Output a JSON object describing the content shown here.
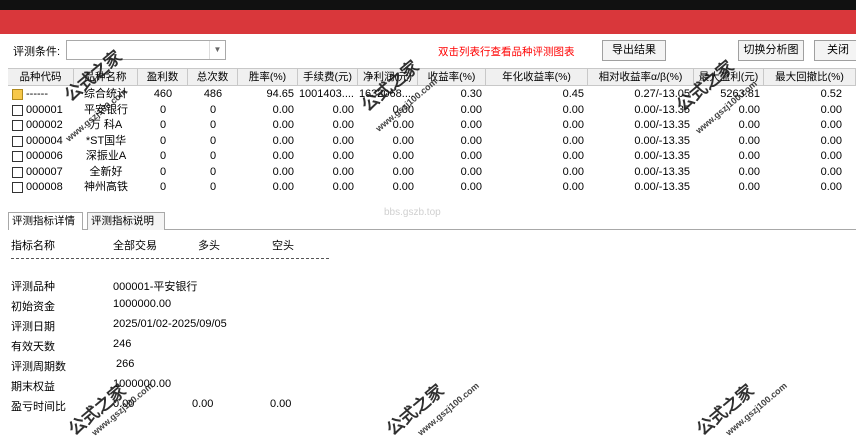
{
  "toolbar": {
    "condition_label": "评测条件:",
    "condition_value": "",
    "hint": "双击列表行查看品种评测图表",
    "export_button": "导出结果",
    "switch_button": "切换分析图",
    "close_button": "关闭"
  },
  "table": {
    "headers": [
      "品种代码",
      "品种名称",
      "盈利数",
      "总次数",
      "胜率(%)",
      "手续费(元)",
      "净利润(元)",
      "收益率(%)",
      "年化收益率(%)",
      "相对收益率α/β(%)",
      "最大盈利(元)",
      "最大回撤比(%)"
    ],
    "rows": [
      {
        "code": "------",
        "name": "综合统计",
        "win": "460",
        "total": "486",
        "rate": "94.65",
        "fee": "1001403....",
        "profit": "1632068....",
        "ret": "0.30",
        "annual": "0.45",
        "alpha": "0.27/-13.05",
        "maxp": "5263.81",
        "dd": "0.52",
        "folder": true
      },
      {
        "code": "000001",
        "name": "平安银行",
        "win": "0",
        "total": "0",
        "rate": "0.00",
        "fee": "0.00",
        "profit": "0.00",
        "ret": "0.00",
        "annual": "0.00",
        "alpha": "0.00/-13.35",
        "maxp": "0.00",
        "dd": "0.00",
        "folder": false
      },
      {
        "code": "000002",
        "name": "万 科A",
        "win": "0",
        "total": "0",
        "rate": "0.00",
        "fee": "0.00",
        "profit": "0.00",
        "ret": "0.00",
        "annual": "0.00",
        "alpha": "0.00/-13.35",
        "maxp": "0.00",
        "dd": "0.00",
        "folder": false
      },
      {
        "code": "000004",
        "name": "*ST国华",
        "win": "0",
        "total": "0",
        "rate": "0.00",
        "fee": "0.00",
        "profit": "0.00",
        "ret": "0.00",
        "annual": "0.00",
        "alpha": "0.00/-13.35",
        "maxp": "0.00",
        "dd": "0.00",
        "folder": false
      },
      {
        "code": "000006",
        "name": "深振业A",
        "win": "0",
        "total": "0",
        "rate": "0.00",
        "fee": "0.00",
        "profit": "0.00",
        "ret": "0.00",
        "annual": "0.00",
        "alpha": "0.00/-13.35",
        "maxp": "0.00",
        "dd": "0.00",
        "folder": false
      },
      {
        "code": "000007",
        "name": "全新好",
        "win": "0",
        "total": "0",
        "rate": "0.00",
        "fee": "0.00",
        "profit": "0.00",
        "ret": "0.00",
        "annual": "0.00",
        "alpha": "0.00/-13.35",
        "maxp": "0.00",
        "dd": "0.00",
        "folder": false
      },
      {
        "code": "000008",
        "name": "神州高铁",
        "win": "0",
        "total": "0",
        "rate": "0.00",
        "fee": "0.00",
        "profit": "0.00",
        "ret": "0.00",
        "annual": "0.00",
        "alpha": "0.00/-13.35",
        "maxp": "0.00",
        "dd": "0.00",
        "folder": false
      }
    ]
  },
  "tabs": [
    "评测指标详情",
    "评测指标说明"
  ],
  "detail": {
    "header": {
      "name": "指标名称",
      "all": "全部交易",
      "long": "多头",
      "short": "空头"
    },
    "items": [
      {
        "label": "评测品种",
        "value": "000001-平安银行"
      },
      {
        "label": "初始资金",
        "value": "1000000.00"
      },
      {
        "label": "评测日期",
        "value": "2025/01/02-2025/09/05"
      },
      {
        "label": "有效天数",
        "value": "246"
      },
      {
        "label": "评测周期数",
        "value": " 266"
      },
      {
        "label": "期末权益",
        "value": "1000000.00"
      },
      {
        "label": "盈亏时间比",
        "value": "0.00",
        "long": "0.00",
        "short": "0.00"
      }
    ]
  },
  "watermark": {
    "brand": "公式之家",
    "url": "www.gszj100.com",
    "faint": "bbs.gszb.top"
  },
  "colors": {
    "accent_red": "#d9373b",
    "hint_red": "#ff0000"
  }
}
